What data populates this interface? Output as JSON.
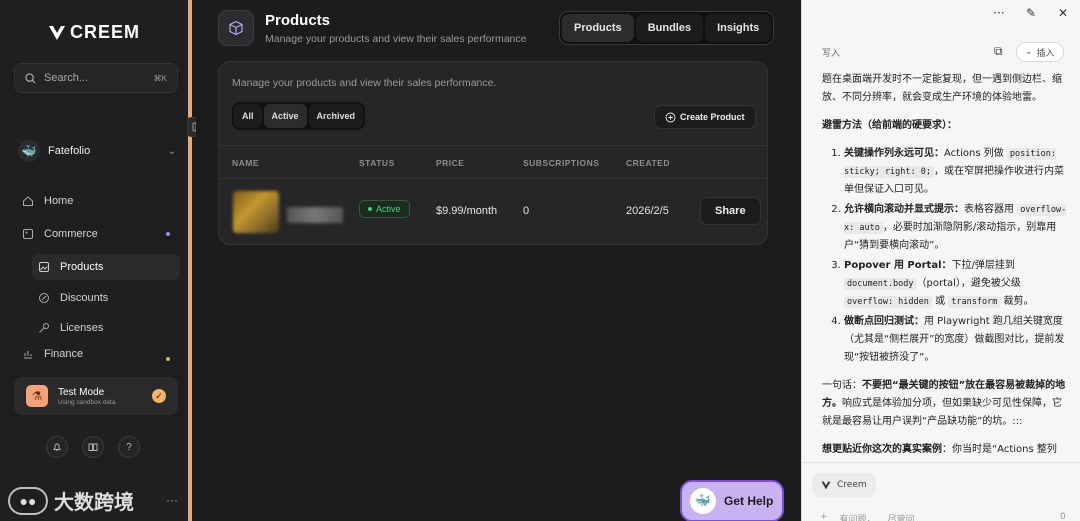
{
  "sidebar": {
    "logo_text": "CREEM",
    "search": {
      "placeholder": "Search...",
      "shortcut": "⌘K"
    },
    "org_name": "Fatefolio",
    "nav": [
      {
        "label": "Home"
      },
      {
        "label": "Commerce"
      },
      {
        "label": "Products"
      },
      {
        "label": "Discounts"
      },
      {
        "label": "Licenses"
      },
      {
        "label": "Finance"
      }
    ],
    "test_mode": {
      "title": "Test Mode",
      "subtitle": "Using sandbox data"
    },
    "accent_color": "#e7a87c"
  },
  "watermark": {
    "text": "大数跨境"
  },
  "header": {
    "title": "Products",
    "subtitle": "Manage your products and view their sales performance",
    "tabs": [
      {
        "label": "Products"
      },
      {
        "label": "Bundles"
      },
      {
        "label": "Insights"
      }
    ]
  },
  "card": {
    "subtitle": "Manage your products and view their sales performance.",
    "filters": [
      {
        "label": "All"
      },
      {
        "label": "Active"
      },
      {
        "label": "Archived"
      }
    ],
    "create_label": "Create Product",
    "columns": {
      "name": "NAME",
      "status": "STATUS",
      "price": "PRICE",
      "subscriptions": "SUBSCRIPTIONS",
      "created": "CREATED"
    },
    "rows": [
      {
        "status": "Active",
        "price": "$9.99/month",
        "subscriptions": "0",
        "created": "2026/2/5",
        "action": "Share"
      }
    ]
  },
  "help_button": "Get Help",
  "panel": {
    "write_label": "写入",
    "insert_label": "插入",
    "intro": "题在桌面端开发时不一定能复现，但一遇到侧边栏、缩放、不同分辨率，就会变成生产环境的体验地雷。",
    "section_title": "避雷方法（给前端的硬要求）：",
    "items": [
      {
        "bold": "关键操作列永远可见：",
        "pre": "Actions 列做 ",
        "code1": "position: sticky; right: 0;",
        "post": "，或在窄屏把操作收进行内菜单但保证入口可见。"
      },
      {
        "bold": "允许横向滚动并显式提示：",
        "pre": "表格容器用 ",
        "code1": "overflow-x: auto",
        "post": "，必要时加渐隐阴影/滚动指示，别靠用户“猜到要横向滚动”。"
      },
      {
        "bold": "Popover 用 Portal：",
        "pre": "下拉/弹层挂到 ",
        "code1": "document.body",
        "mid": "（portal），避免被父级 ",
        "code2": "overflow: hidden",
        "mid2": " 或 ",
        "code3": "transform",
        "post": " 裁剪。"
      },
      {
        "bold": "做断点回归测试：",
        "pre": "用 Playwright 跑几组关键宽度（尤其是“侧栏展开”的宽度）做截图对比，提前发现“按钮被挤没了”。"
      }
    ],
    "summary_pre": "一句话：",
    "summary_bold": "不要把“最关键的按钮”放在最容易被裁掉的地方。",
    "summary_post": "响应式是体验加分项，但如果缺少可见性保障，它就是最容易让用户误判“产品缺功能”的坑。:::",
    "case_bold": "想更贴近你这次的真实案例",
    "case_post": "：你当时是“Actions 整列",
    "chip_label": "Creem",
    "composer_a": "有问题，",
    "composer_b": "尽管问",
    "composer_count": "0"
  }
}
